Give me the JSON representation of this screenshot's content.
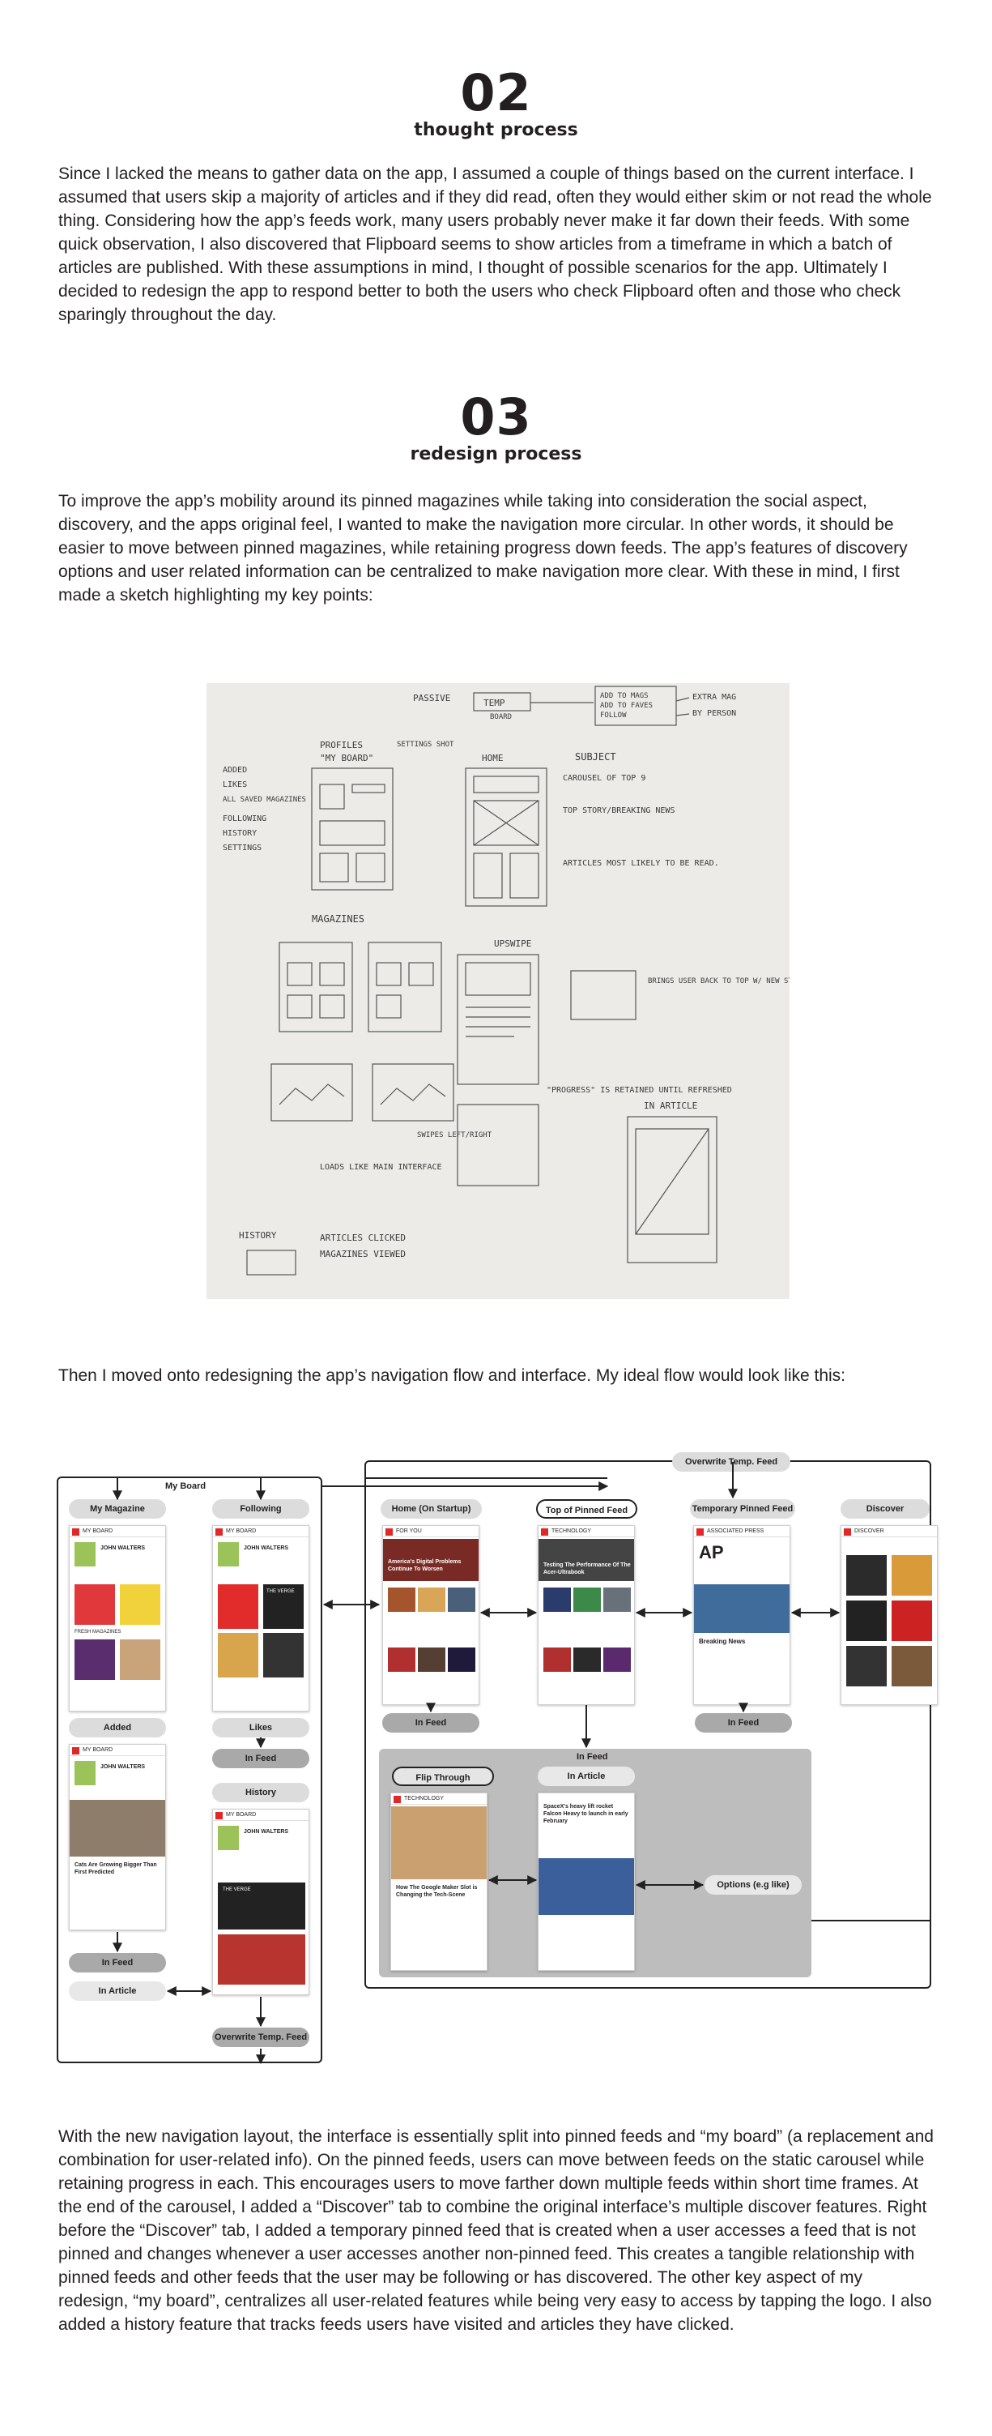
{
  "section2": {
    "number": "02",
    "title": "thought process",
    "body": "Since I lacked the means to gather data on the app, I assumed a couple of things based on the current interface. I assumed that users skip a majority of articles and if they did read, often they would either skim or not read the whole thing. Considering how the app’s feeds work, many users probably never make it far down their feeds. With some quick observation, I also discovered that Flipboard seems to show articles from a timeframe in which a batch of articles are published. With these assumptions in mind, I thought of possible scenarios for the app. Ultimately I decided to redesign the app to respond better to both the users who check Flipboard often and those who check sparingly throughout the day."
  },
  "section3": {
    "number": "03",
    "title": "redesign process",
    "body": "To improve the app’s mobility around its pinned magazines while taking into consideration the social aspect, discovery, and the apps original feel, I wanted to make the navigation more circular. In other words, it should be easier to move between pinned magazines, while retaining progress down feeds. The app’s features of discovery options and user related information can be centralized to make navigation more clear. With these in mind, I first made a sketch highlighting my key points:"
  },
  "sketch": {
    "labels": {
      "passive": "PASSIVE",
      "temp": "TEMP",
      "board": "BOARD",
      "add_to_mags": "ADD TO MAGS",
      "add_to_faves": "ADD TO FAVES",
      "follow": "FOLLOW",
      "extra_mag": "EXTRA MAG",
      "by_person": "BY PERSON",
      "profiles": "PROFILES",
      "my_board": "\"MY BOARD\"",
      "settings_shot": "SETTINGS SHOT",
      "home": "HOME",
      "added": "ADDED",
      "likes": "LIKES",
      "all_saved_magazines": "ALL SAVED MAGAZINES",
      "following": "FOLLOWING",
      "history": "HISTORY",
      "settings": "SETTINGS",
      "carousel": "CAROUSEL OF TOP 9",
      "subject": "SUBJECT",
      "top_story": "TOP STORY/BREAKING NEWS",
      "articles_likely": "ARTICLES MOST LIKELY TO BE READ.",
      "magazines": "MAGAZINES",
      "upswipe": "UPSWIPE",
      "brings_user_back": "BRINGS USER BACK TO TOP W/ NEW STORIES FOR SPECIFIC AREA. \"RECOVERY AFTER EACH UPDATE CYCLE",
      "progress_retained": "\"PROGRESS\" IS RETAINED UNTIL REFRESHED",
      "swipes": "SWIPES LEFT/RIGHT",
      "in_article": "IN ARTICLE",
      "loads_like": "LOADS LIKE MAIN INTERFACE",
      "history_bottom": "HISTORY",
      "articles_clicked": "ARTICLES CLICKED",
      "magazines_viewed": "MAGAZINES VIEWED"
    }
  },
  "transition_text": "Then I moved onto redesigning the app’s navigation flow and interface. My ideal flow would look like this:",
  "flow": {
    "my_board": "My Board",
    "my_magazine": "My Magazine",
    "following": "Following",
    "added": "Added",
    "likes": "Likes",
    "history": "History",
    "in_feed": "In Feed",
    "in_article": "In Article",
    "overwrite_temp_feed": "Overwrite Temp. Feed",
    "home_startup": "Home (On Startup)",
    "top_pinned_feed": "Top of Pinned Feed",
    "temporary_pinned_feed": "Temporary Pinned Feed",
    "discover": "Discover",
    "flip_through": "Flip Through",
    "options": "Options (e.g like)",
    "phone_texts": {
      "my_board_bar": "MY BOARD",
      "john_walters": "JOHN WALTERS",
      "for_you": "FOR YOU",
      "technology": "TECHNOLOGY",
      "associated_press": "ASSOCIATED PRESS",
      "discover_bar": "DISCOVER",
      "home_headline": "America's Digital Problems Continue To Worsen",
      "tech_headline": "Testing The Performance Of The Acer-Ultrabook",
      "ap_headline": "Breaking News",
      "flip_headline": "How The Google Maker Slot is Changing the Tech-Scene",
      "article_headline": "SpaceX's heavy lift rocket Falcon Heavy to launch in early February",
      "cat_headline": "Cats Are Growing Bigger Than First Predicted",
      "verge": "THE VERGE",
      "fresh_magazines": "FRESH MAGAZINES"
    }
  },
  "closing_text": "With the new navigation layout, the interface is essentially split into pinned feeds and “my board” (a replacement and combination for user-related info). On the pinned feeds, users can move between feeds on the static carousel while retaining progress in each. This encourages users to move farther down multiple feeds within short time frames. At the end of the carousel, I added a “Discover” tab to combine the original interface’s multiple discover features. Right before the “Discover” tab, I added a temporary pinned feed that is created when a user accesses a feed that is not pinned and changes whenever a user accesses another non-pinned feed. This creates a tangible relationship with pinned feeds and other feeds that the user may be following or has discovered. The other key aspect of my redesign, “my board”, centralizes all user-related features while being very easy to access by tapping the logo. I also added a history feature that tracks feeds users have visited and articles they have clicked.",
  "colors": {
    "flipboard_red": "#e12828",
    "pill_gray": "#dcdcdc",
    "feed_panel": "#bdbdbd"
  }
}
